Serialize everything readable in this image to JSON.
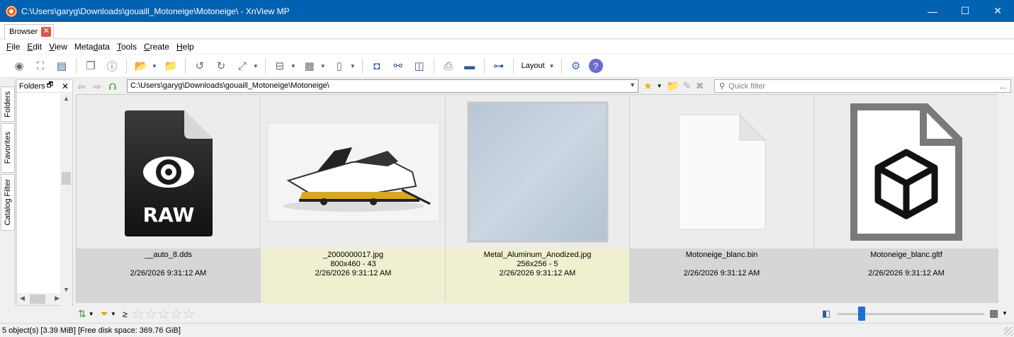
{
  "window": {
    "title": "C:\\Users\\garyg\\Downloads\\gouaill_Motoneige\\Motoneige\\ - XnView MP",
    "minimize": "—",
    "maximize": "☐",
    "close": "✕"
  },
  "tab": {
    "label": "Browser",
    "close": "✕"
  },
  "menu": [
    {
      "pre": "",
      "u": "F",
      "post": "ile"
    },
    {
      "pre": "",
      "u": "E",
      "post": "dit"
    },
    {
      "pre": "",
      "u": "V",
      "post": "iew"
    },
    {
      "pre": "Meta",
      "u": "d",
      "post": "ata"
    },
    {
      "pre": "",
      "u": "T",
      "post": "ools"
    },
    {
      "pre": "",
      "u": "C",
      "post": "reate"
    },
    {
      "pre": "",
      "u": "H",
      "post": "elp"
    }
  ],
  "toolbar": {
    "layout_label": "Layout"
  },
  "sidetabs": {
    "folders": "Folders",
    "favorites": "Favorites",
    "catalog": "Catalog Filter"
  },
  "folders_pane": {
    "title": "Folders",
    "pin": "🗗",
    "close": "✕"
  },
  "address": {
    "path": "C:\\Users\\garyg\\Downloads\\gouaill_Motoneige\\Motoneige\\",
    "quick_filter_placeholder": "Quick filter",
    "more": "..."
  },
  "files": [
    {
      "name": "__auto_8.dds",
      "info": "",
      "date": "2/26/2026 9:31:12 AM",
      "style": "gray",
      "thumb": "raw"
    },
    {
      "name": "_2000000017.jpg",
      "info": "800x460 - 43",
      "date": "2/26/2026 9:31:12 AM",
      "style": "yellow",
      "thumb": "snowmobile"
    },
    {
      "name": "Metal_Aluminum_Anodized.jpg",
      "info": "256x256 - 5",
      "date": "2/26/2026 9:31:12 AM",
      "style": "yellow",
      "thumb": "metal"
    },
    {
      "name": "Motoneige_blanc.bin",
      "info": "",
      "date": "2/26/2026 9:31:12 AM",
      "style": "gray",
      "thumb": "blank"
    },
    {
      "name": "Motoneige_blanc.gltf",
      "info": "",
      "date": "2/26/2026 9:31:12 AM",
      "style": "gray",
      "thumb": "gltf"
    }
  ],
  "raw_label": "RAW",
  "bottom": {
    "ge": "≥",
    "stars": "☆☆☆☆☆"
  },
  "status": {
    "text": "5 object(s) [3.39 MiB] [Free disk space: 369.76 GiB]"
  }
}
